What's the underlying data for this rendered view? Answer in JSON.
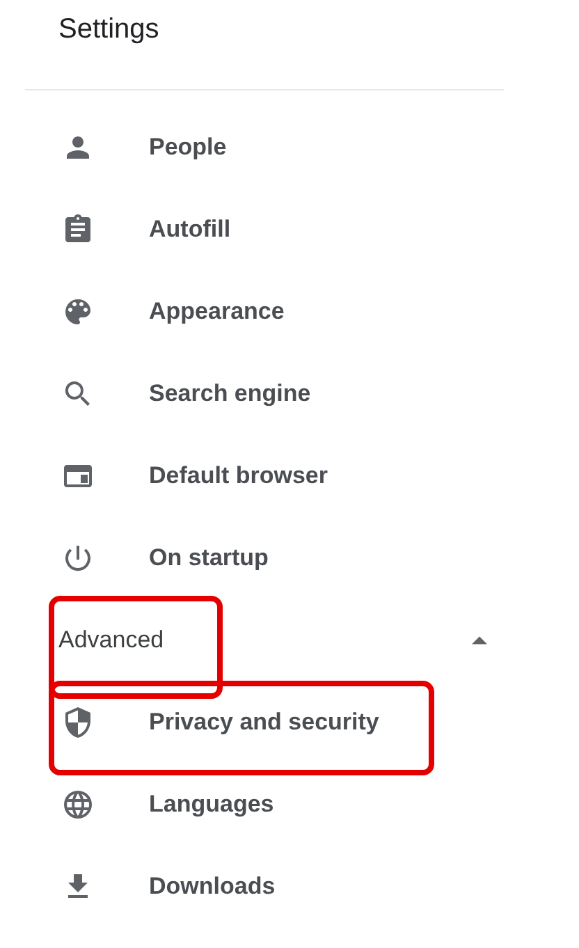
{
  "title": "Settings",
  "items": [
    {
      "label": "People",
      "highlighted": false
    },
    {
      "label": "Autofill",
      "highlighted": false
    },
    {
      "label": "Appearance",
      "highlighted": false
    },
    {
      "label": "Search engine",
      "highlighted": false
    },
    {
      "label": "Default browser",
      "highlighted": false
    },
    {
      "label": "On startup",
      "highlighted": false
    }
  ],
  "advanced": {
    "label": "Advanced",
    "expanded": true,
    "highlighted": true,
    "items": [
      {
        "label": "Privacy and security",
        "highlighted": true
      },
      {
        "label": "Languages",
        "highlighted": false
      },
      {
        "label": "Downloads",
        "highlighted": false
      }
    ]
  }
}
